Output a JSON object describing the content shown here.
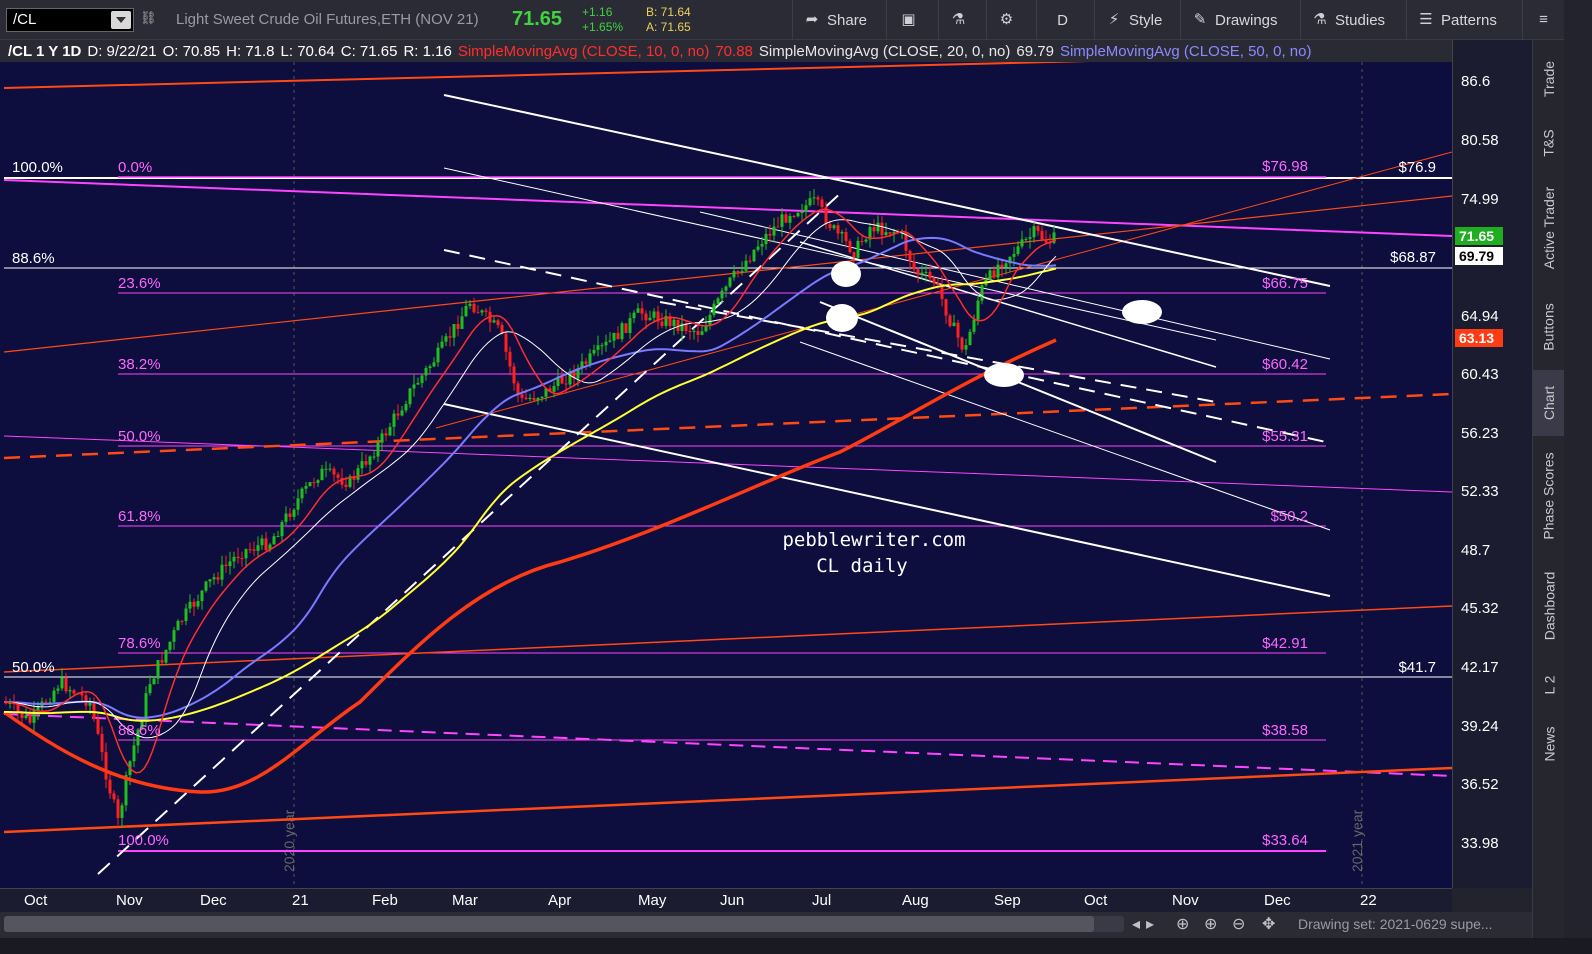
{
  "toolbar": {
    "symbol": "/CL",
    "description": "Light Sweet Crude Oil Futures,ETH (NOV 21)",
    "last": "71.65",
    "change_abs": "+1.16",
    "change_pct": "+1.65%",
    "bid": "B: 71.64",
    "ask": "A: 71.65",
    "buttons": {
      "share": "Share",
      "timeframe": "D",
      "style": "Style",
      "drawings": "Drawings",
      "studies": "Studies",
      "patterns": "Patterns"
    }
  },
  "infobar": {
    "title": "/CL 1 Y 1D",
    "date": "D: 9/22/21",
    "open": "O: 70.85",
    "high": "H: 71.8",
    "low": "L: 70.64",
    "close": "C: 71.65",
    "range": "R: 1.16",
    "sma10_label": "SimpleMovingAvg (CLOSE, 10, 0, no)",
    "sma10_val": "70.88",
    "sma20_label": "SimpleMovingAvg (CLOSE, 20, 0, no)",
    "sma20_val": "69.79",
    "sma50_label": "SimpleMovingAvg (CLOSE, 50, 0, no)"
  },
  "price_axis": {
    "ticks": [
      "86.6",
      "80.58",
      "74.99",
      "64.94",
      "60.43",
      "56.23",
      "52.33",
      "48.7",
      "45.32",
      "42.17",
      "39.24",
      "36.52",
      "33.98"
    ],
    "tags": [
      {
        "text": "71.65",
        "bg": "#1fae1f",
        "color": "#ffffff"
      },
      {
        "text": "69.79",
        "bg": "#ffffff",
        "color": "#000000"
      },
      {
        "text": "63.13",
        "bg": "#ff3b14",
        "color": "#ffffff"
      }
    ]
  },
  "time_axis": {
    "labels": [
      "Oct",
      "Nov",
      "Dec",
      "21",
      "Feb",
      "Mar",
      "Apr",
      "May",
      "Jun",
      "Jul",
      "Aug",
      "Sep",
      "Oct",
      "Nov",
      "Dec",
      "22"
    ]
  },
  "chart": {
    "fib_left_labels": {
      "r100": "100.0%",
      "r0": "0.0%",
      "r886": "88.6%",
      "r236": "23.6%",
      "r382": "38.2%",
      "r50": "50.0%",
      "r618": "61.8%",
      "r786": "78.6%",
      "r50b": "50.0%",
      "r886b": "88.6%",
      "r100b": "100.0%"
    },
    "fib_right_labels": {
      "p7698": "$76.98",
      "p6675": "$66.75",
      "p6042": "$60.42",
      "p5531": "$55.31",
      "p502": "$50.2",
      "p4291": "$42.91",
      "p3858": "$38.58",
      "p3364": "$33.64"
    },
    "level_labels": {
      "l769": "$76.9",
      "l6887": "$68.87",
      "l417": "$41.7"
    },
    "watermark": {
      "line1": "pebblewriter.com",
      "line2": "CL daily"
    },
    "year_markers": {
      "y2020": "2020 year",
      "y2021": "2021 year"
    },
    "colors": {
      "background": "#0d0d3e",
      "sma10": "#ff2e2e",
      "sma20": "#ffffff",
      "sma50": "#7a7aff",
      "sma100": "#ffff33",
      "sma200": "#ff3b14",
      "fib": "#ff44ff",
      "up": "#1fbf1f",
      "down": "#ff2020"
    }
  },
  "side_tabs": [
    "Trade",
    "T&S",
    "Active Trader",
    "Buttons",
    "Chart",
    "Phase Scores",
    "Dashboard",
    "L 2",
    "News"
  ],
  "bottom": {
    "drawing_set": "Drawing set: 2021-0629 supe..."
  }
}
